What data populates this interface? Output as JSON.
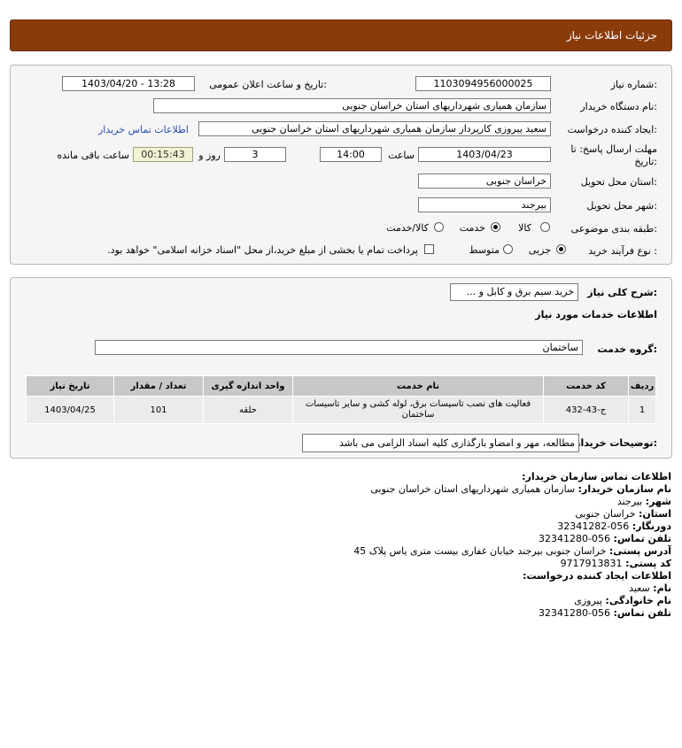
{
  "header": {
    "title": "جزئیات اطلاعات نیاز"
  },
  "form": {
    "need_number_label": "شماره نیاز:",
    "need_number": "1103094956000025",
    "announce_label": "تاریخ و ساعت اعلان عمومی:",
    "announce_value": "1403/04/20 - 13:28",
    "buyer_org_label": "نام دستگاه خریدار:",
    "buyer_org": "سازمان همیاری شهرداریهای استان خراسان جنوبی",
    "creator_label": "ایجاد کننده درخواست:",
    "creator": "سعید پیروزی کارپرداز سازمان همیاری شهرداریهای استان خراسان جنوبی",
    "contact_link": "اطلاعات تماس خریدار",
    "deadline_label_1": "مهلت ارسال پاسخ: تا",
    "deadline_label_2": "تاریخ:",
    "deadline_date": "1403/04/23",
    "time_label": "ساعت",
    "deadline_time": "14:00",
    "days_value": "3",
    "days_label": "روز و",
    "timer_value": "00:15:43",
    "remaining_label": "ساعت باقی مانده",
    "province_label": "استان محل تحویل:",
    "province": "خراسان جنوبی",
    "city_label": "شهر محل تحویل:",
    "city": "بیرجند",
    "category_label": "طبقه بندی موضوعی:",
    "category_options": [
      "کالا",
      "خدمت",
      "کالا/خدمت"
    ],
    "process_label": "نوع فرآیند خرید :",
    "process_options": [
      "جزیی",
      "متوسط"
    ],
    "payment_note": "پرداخت تمام یا بخشی از مبلغ خرید،از محل \"اسناد خزانه اسلامی\" خواهد بود."
  },
  "details": {
    "summary_label": "شرح کلی نیاز:",
    "summary": "خرید سیم برق و کابل و ...",
    "services_title": "اطلاعات خدمات مورد نیاز",
    "group_label": "گروه خدمت:",
    "group_value": "ساختمان",
    "table": {
      "headers": [
        "ردیف",
        "کد خدمت",
        "نام خدمت",
        "واحد اندازه گیری",
        "تعداد / مقدار",
        "تاریخ نیاز"
      ],
      "rows": [
        [
          "1",
          "ج-43-432",
          "فعالیت های نصب تاسیسات برق، لوله کشی و سایر تاسیسات ساختمان",
          "حلقه",
          "101",
          "1403/04/25"
        ]
      ]
    },
    "buyer_notes_label": "توضیحات خریدار:",
    "buyer_notes": "مطالعه، مهر و امضاو بارگذاری کلیه اسناد الزامی می باشد"
  },
  "contact": {
    "title": "اطلاعات تماس سازمان خریدار:",
    "org_label": "نام سازمان خریدار:",
    "org_value": "سازمان همیاری شهرداریهای استان خراسان جنوبی",
    "city_label": "شهر:",
    "city_value": "بیرجند",
    "province_label": "استان:",
    "province_value": "خراسان جنوبی",
    "fax_label": "دورنگار:",
    "fax_value": "056-32341282",
    "phone_label": "تلفن تماس:",
    "phone_value": "056-32341280",
    "address_label": "آدرس پستی:",
    "address_value": "خراسان جنوبی بیرجند خیابان غفاری بیست متری یاس پلاک 45",
    "postal_label": "کد پستی:",
    "postal_value": "9717913831",
    "creator_title": "اطلاعات ایجاد کننده درخواست:",
    "name_label": "نام:",
    "name_value": "سعید",
    "family_label": "نام خانوادگی:",
    "family_value": "پیروزی",
    "creator_phone_label": "تلفن تماس:",
    "creator_phone_value": "056-32341280"
  }
}
